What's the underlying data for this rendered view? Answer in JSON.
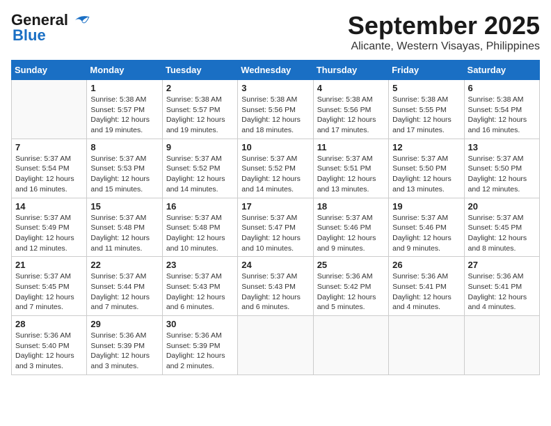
{
  "logo": {
    "general": "General",
    "blue": "Blue"
  },
  "title": "September 2025",
  "location": "Alicante, Western Visayas, Philippines",
  "days_of_week": [
    "Sunday",
    "Monday",
    "Tuesday",
    "Wednesday",
    "Thursday",
    "Friday",
    "Saturday"
  ],
  "weeks": [
    [
      {
        "day": "",
        "info": ""
      },
      {
        "day": "1",
        "info": "Sunrise: 5:38 AM\nSunset: 5:57 PM\nDaylight: 12 hours\nand 19 minutes."
      },
      {
        "day": "2",
        "info": "Sunrise: 5:38 AM\nSunset: 5:57 PM\nDaylight: 12 hours\nand 19 minutes."
      },
      {
        "day": "3",
        "info": "Sunrise: 5:38 AM\nSunset: 5:56 PM\nDaylight: 12 hours\nand 18 minutes."
      },
      {
        "day": "4",
        "info": "Sunrise: 5:38 AM\nSunset: 5:56 PM\nDaylight: 12 hours\nand 17 minutes."
      },
      {
        "day": "5",
        "info": "Sunrise: 5:38 AM\nSunset: 5:55 PM\nDaylight: 12 hours\nand 17 minutes."
      },
      {
        "day": "6",
        "info": "Sunrise: 5:38 AM\nSunset: 5:54 PM\nDaylight: 12 hours\nand 16 minutes."
      }
    ],
    [
      {
        "day": "7",
        "info": "Sunrise: 5:37 AM\nSunset: 5:54 PM\nDaylight: 12 hours\nand 16 minutes."
      },
      {
        "day": "8",
        "info": "Sunrise: 5:37 AM\nSunset: 5:53 PM\nDaylight: 12 hours\nand 15 minutes."
      },
      {
        "day": "9",
        "info": "Sunrise: 5:37 AM\nSunset: 5:52 PM\nDaylight: 12 hours\nand 14 minutes."
      },
      {
        "day": "10",
        "info": "Sunrise: 5:37 AM\nSunset: 5:52 PM\nDaylight: 12 hours\nand 14 minutes."
      },
      {
        "day": "11",
        "info": "Sunrise: 5:37 AM\nSunset: 5:51 PM\nDaylight: 12 hours\nand 13 minutes."
      },
      {
        "day": "12",
        "info": "Sunrise: 5:37 AM\nSunset: 5:50 PM\nDaylight: 12 hours\nand 13 minutes."
      },
      {
        "day": "13",
        "info": "Sunrise: 5:37 AM\nSunset: 5:50 PM\nDaylight: 12 hours\nand 12 minutes."
      }
    ],
    [
      {
        "day": "14",
        "info": "Sunrise: 5:37 AM\nSunset: 5:49 PM\nDaylight: 12 hours\nand 12 minutes."
      },
      {
        "day": "15",
        "info": "Sunrise: 5:37 AM\nSunset: 5:48 PM\nDaylight: 12 hours\nand 11 minutes."
      },
      {
        "day": "16",
        "info": "Sunrise: 5:37 AM\nSunset: 5:48 PM\nDaylight: 12 hours\nand 10 minutes."
      },
      {
        "day": "17",
        "info": "Sunrise: 5:37 AM\nSunset: 5:47 PM\nDaylight: 12 hours\nand 10 minutes."
      },
      {
        "day": "18",
        "info": "Sunrise: 5:37 AM\nSunset: 5:46 PM\nDaylight: 12 hours\nand 9 minutes."
      },
      {
        "day": "19",
        "info": "Sunrise: 5:37 AM\nSunset: 5:46 PM\nDaylight: 12 hours\nand 9 minutes."
      },
      {
        "day": "20",
        "info": "Sunrise: 5:37 AM\nSunset: 5:45 PM\nDaylight: 12 hours\nand 8 minutes."
      }
    ],
    [
      {
        "day": "21",
        "info": "Sunrise: 5:37 AM\nSunset: 5:45 PM\nDaylight: 12 hours\nand 7 minutes."
      },
      {
        "day": "22",
        "info": "Sunrise: 5:37 AM\nSunset: 5:44 PM\nDaylight: 12 hours\nand 7 minutes."
      },
      {
        "day": "23",
        "info": "Sunrise: 5:37 AM\nSunset: 5:43 PM\nDaylight: 12 hours\nand 6 minutes."
      },
      {
        "day": "24",
        "info": "Sunrise: 5:37 AM\nSunset: 5:43 PM\nDaylight: 12 hours\nand 6 minutes."
      },
      {
        "day": "25",
        "info": "Sunrise: 5:36 AM\nSunset: 5:42 PM\nDaylight: 12 hours\nand 5 minutes."
      },
      {
        "day": "26",
        "info": "Sunrise: 5:36 AM\nSunset: 5:41 PM\nDaylight: 12 hours\nand 4 minutes."
      },
      {
        "day": "27",
        "info": "Sunrise: 5:36 AM\nSunset: 5:41 PM\nDaylight: 12 hours\nand 4 minutes."
      }
    ],
    [
      {
        "day": "28",
        "info": "Sunrise: 5:36 AM\nSunset: 5:40 PM\nDaylight: 12 hours\nand 3 minutes."
      },
      {
        "day": "29",
        "info": "Sunrise: 5:36 AM\nSunset: 5:39 PM\nDaylight: 12 hours\nand 3 minutes."
      },
      {
        "day": "30",
        "info": "Sunrise: 5:36 AM\nSunset: 5:39 PM\nDaylight: 12 hours\nand 2 minutes."
      },
      {
        "day": "",
        "info": ""
      },
      {
        "day": "",
        "info": ""
      },
      {
        "day": "",
        "info": ""
      },
      {
        "day": "",
        "info": ""
      }
    ]
  ]
}
